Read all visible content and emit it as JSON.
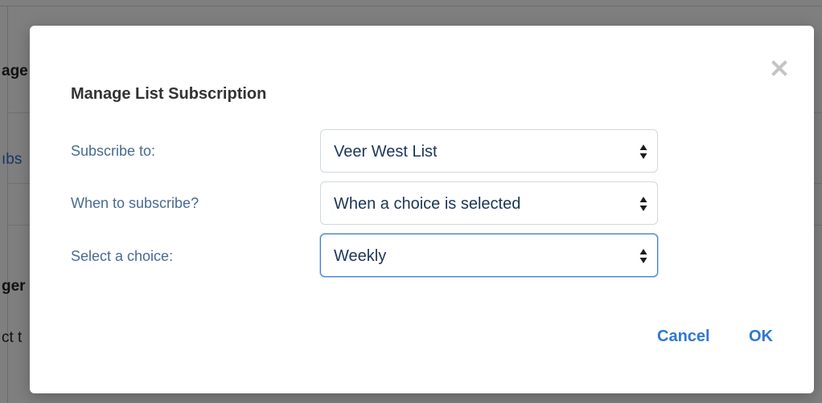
{
  "background": {
    "fragments": [
      "age",
      "ıbs",
      "ger",
      "ct t"
    ]
  },
  "dialog": {
    "title": "Manage List Subscription",
    "close_icon": "close-icon",
    "fields": [
      {
        "label": "Subscribe to:",
        "value": "Veer West List",
        "focused": false
      },
      {
        "label": "When to subscribe?",
        "value": "When a choice is selected",
        "focused": false
      },
      {
        "label": "Select a choice:",
        "value": "Weekly",
        "focused": true
      }
    ],
    "cancel_label": "Cancel",
    "ok_label": "OK"
  },
  "colors": {
    "accent": "#3177d2",
    "label": "#4a6a93",
    "value": "#1d3557",
    "focus_border": "#3c7dd6"
  }
}
